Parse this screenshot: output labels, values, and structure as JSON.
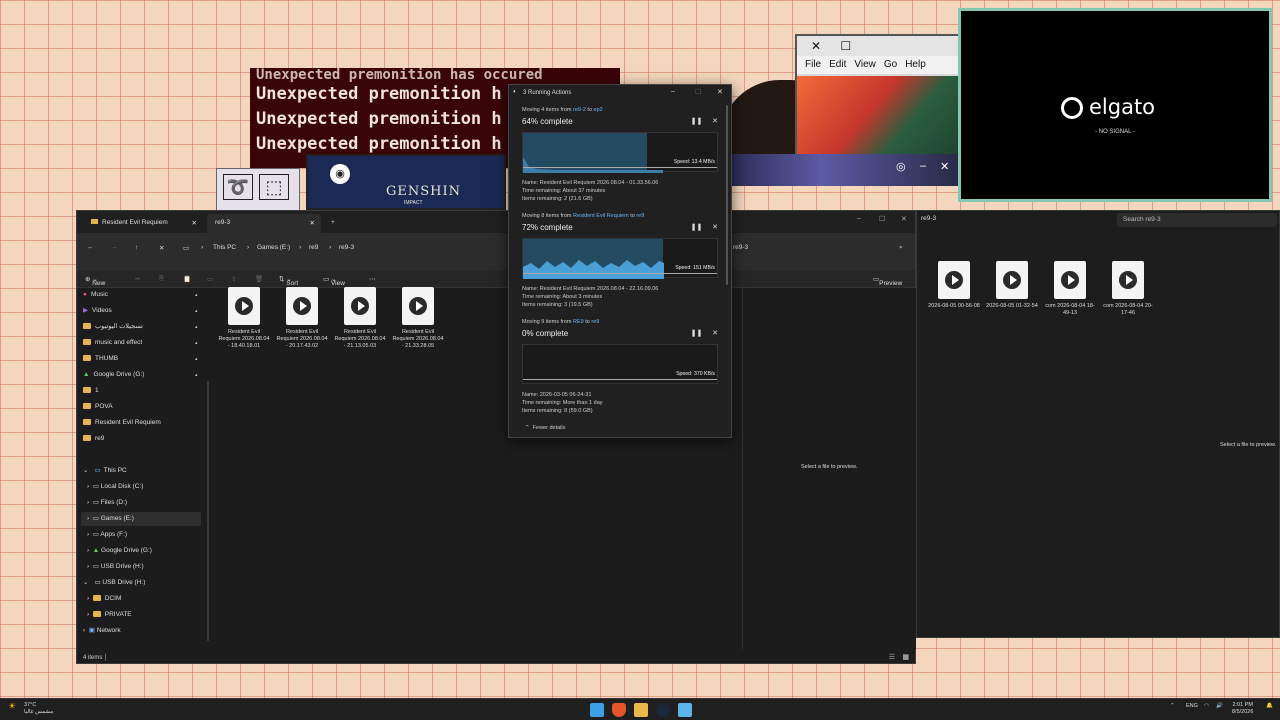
{
  "premonition": {
    "lines": [
      "Unexpected premonition has occured",
      "Unexpected premonition h",
      "Unexpected premonition h",
      "Unexpected premonition h"
    ]
  },
  "genshin": {
    "logo": "GENSHIN",
    "sub": "IMPACT"
  },
  "retro_window": {
    "menu": [
      "File",
      "Edit",
      "View",
      "Go",
      "Help"
    ]
  },
  "elgato": {
    "brand": "elgato",
    "status": "- NO SIGNAL -"
  },
  "explorer_main": {
    "tabs": [
      {
        "label": "Resident Evil Requiem"
      },
      {
        "label": "re9-3"
      }
    ],
    "breadcrumb": [
      "This PC",
      "Games (E:)",
      "re9",
      "re9-3"
    ],
    "toolbar": {
      "new": "New",
      "sort": "Sort",
      "view": "View",
      "preview": "Preview"
    },
    "quick_access": [
      {
        "label": "Music"
      },
      {
        "label": "Videos"
      },
      {
        "label": "تسجيلات اليوتيوب"
      },
      {
        "label": "music and effect"
      },
      {
        "label": "THUMB"
      },
      {
        "label": "Google Drive (G:)"
      },
      {
        "label": "1"
      },
      {
        "label": "POVA"
      },
      {
        "label": "Resident Evil Requiem"
      },
      {
        "label": "re9"
      }
    ],
    "this_pc": {
      "label": "This PC",
      "drives": [
        {
          "label": "Local Disk (C:)"
        },
        {
          "label": "Files (D:)"
        },
        {
          "label": "Games (E:)"
        },
        {
          "label": "Apps (F:)"
        },
        {
          "label": "Google Drive (G:)"
        },
        {
          "label": "USB Drive (H:)"
        }
      ]
    },
    "usb": {
      "label": "USB Drive (H:)",
      "children": [
        {
          "label": "DCIM"
        },
        {
          "label": "PRIVATE"
        }
      ]
    },
    "network": "Network",
    "files": [
      {
        "name": "Resident Evil Requiem 2026.08.04 - 18.40.18.01"
      },
      {
        "name": "Resident Evil Requiem 2026.08.04 - 20.17.43.02"
      },
      {
        "name": "Resident Evil Requiem 2026.08.04 - 21.13.05.03"
      },
      {
        "name": "Resident Evil Requiem 2026.08.04 - 21.33.28.05"
      }
    ],
    "status": "4 items",
    "preview_hint": "Select a file to preview.",
    "address_tail": "re9-3"
  },
  "explorer_second": {
    "crumb": "re9-3",
    "search_placeholder": "Search re9-3",
    "files": [
      {
        "name": "2026-08-05 00-56-08"
      },
      {
        "name": "2026-08-05 01-32-54"
      },
      {
        "name": "com 2026-08-04 18-49-13"
      },
      {
        "name": "com 2026-08-04 20-17-46"
      }
    ],
    "preview_hint": "Select a file to preview."
  },
  "running_actions": {
    "title": "3 Running Actions",
    "fewer_details": "Fewer details",
    "ops": [
      {
        "moving": "Moving 4 items from",
        "from": "re9-2",
        "to_word": "to",
        "to": "ep2",
        "percent_label": "64% complete",
        "progress": 0.64,
        "speed": "Speed: 13.4 MB/s",
        "name": "Name:  Resident Evil Requiem 2026.08.04 - 01.33.56.06",
        "time": "Time remaining:  About 37 minutes",
        "items": "Items remaining:  2 (21.6 GB)"
      },
      {
        "moving": "Moving 8 items from",
        "from": "Resident Evil Requiem",
        "to_word": "to",
        "to": "re9",
        "percent_label": "72% complete",
        "progress": 0.72,
        "speed": "Speed: 151 MB/s",
        "name": "Name:  Resident Evil Requiem 2026.08.04 - 22.16.09.06",
        "time": "Time remaining:  About 3 minutes",
        "items": "Items remaining:  3 (19.5 GB)"
      },
      {
        "moving": "Moving 9 items from",
        "from": "RE9",
        "to_word": "to",
        "to": "re9",
        "percent_label": "0% complete",
        "progress": 0.0,
        "speed": "Speed: 370 KB/s",
        "name": "Name:  2026-03-05 06-24-31",
        "time": "Time remaining:  More than 1 day",
        "items": "Items remaining:  8 (59.0 GB)"
      }
    ]
  },
  "taskbar": {
    "weather_temp": "37°C",
    "weather_desc": "مشمس غالبا",
    "lang": "ENG",
    "time": "2:01 PM",
    "date": "8/5/2026"
  },
  "colors": {
    "accent": "#6cb8ff",
    "graph_fill": "#254b63",
    "folder": "#e6b44c",
    "elgato_border": "#84c7b2"
  }
}
